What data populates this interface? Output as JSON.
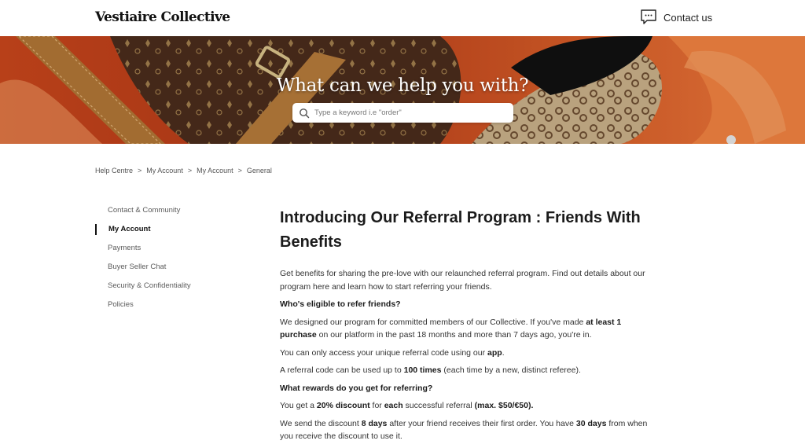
{
  "header": {
    "logo": "Vestiaire Collective",
    "contact_label": "Contact us"
  },
  "hero": {
    "title": "What can we help you with?",
    "search_placeholder": "Type a keyword i.e \"order\""
  },
  "breadcrumb": [
    "Help Centre",
    "My Account",
    "My Account",
    "General"
  ],
  "sidebar": {
    "items": [
      {
        "label": "Contact & Community",
        "active": false
      },
      {
        "label": "My Account",
        "active": true
      },
      {
        "label": "Payments",
        "active": false
      },
      {
        "label": "Buyer Seller Chat",
        "active": false
      },
      {
        "label": "Security & Confidentiality",
        "active": false
      },
      {
        "label": "Policies",
        "active": false
      }
    ]
  },
  "article": {
    "title": "Introducing Our Referral Program : Friends With Benefits",
    "intro": "Get benefits for sharing the pre-love with our relaunched referral program. Find out details about our program here and learn how to start referring your friends.",
    "q1": "Who's eligible to refer friends?",
    "p1": {
      "a": "We designed our program for committed members of our Collective. If you've made ",
      "b": "at least 1 purchase",
      "c": " on our platform in the past 18 months and more than 7 days ago, you're in."
    },
    "p2": {
      "a": "You can only access your unique referral code using our ",
      "b": "app",
      "c": "."
    },
    "p3": {
      "a": "A referral code can be used up to ",
      "b": "100 times",
      "c": " (each time by a new, distinct referee)."
    },
    "q2": "What rewards do you get for referring?",
    "p4": {
      "a": "You get a ",
      "b": "20% discount",
      "c": " for ",
      "d": "each",
      "e": " successful referral ",
      "f": "(max. $50/€50)."
    },
    "p5": {
      "a": "We send the discount ",
      "b": "8 days",
      "c": " after your friend receives their first order. You have ",
      "d": "30 days",
      "e": " from when you receive the discount to use it."
    }
  },
  "colors": {
    "hero_orange": "#e0642d",
    "text_dark": "#1b1b1b",
    "text_muted": "#5b5b5b"
  },
  "icons": {
    "contact": "chat-bubble-icon",
    "search": "magnifier-icon"
  }
}
